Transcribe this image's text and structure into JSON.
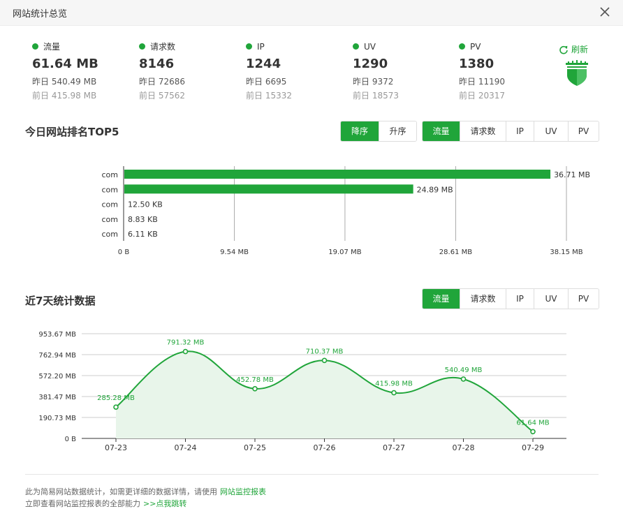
{
  "window": {
    "title": "网站统计总览"
  },
  "stats": [
    {
      "label": "流量",
      "value": "61.64 MB",
      "yesterday": "昨日 540.49 MB",
      "before": "前日 415.98 MB"
    },
    {
      "label": "请求数",
      "value": "8146",
      "yesterday": "昨日 72686",
      "before": "前日 57562"
    },
    {
      "label": "IP",
      "value": "1244",
      "yesterday": "昨日 6695",
      "before": "前日 15332"
    },
    {
      "label": "UV",
      "value": "1290",
      "yesterday": "昨日 9372",
      "before": "前日 18573"
    },
    {
      "label": "PV",
      "value": "1380",
      "yesterday": "昨日 11190",
      "before": "前日 20317"
    }
  ],
  "refresh_label": "刷新",
  "top5": {
    "title": "今日网站排名TOP5",
    "sort_buttons": [
      "降序",
      "升序"
    ],
    "sort_active": 0,
    "metric_buttons": [
      "流量",
      "请求数",
      "IP",
      "UV",
      "PV"
    ],
    "metric_active": 0
  },
  "week": {
    "title": "近7天统计数据",
    "metric_buttons": [
      "流量",
      "请求数",
      "IP",
      "UV",
      "PV"
    ],
    "metric_active": 0
  },
  "chart_data": [
    {
      "type": "bar",
      "orientation": "horizontal",
      "categories": [
        "com",
        "com",
        "com",
        "com",
        "com"
      ],
      "values": [
        36.71,
        24.89,
        0.0122,
        0.0086,
        0.006
      ],
      "value_labels": [
        "36.71 MB",
        "24.89 MB",
        "12.50 KB",
        "8.83 KB",
        "6.11 KB"
      ],
      "unit": "MB",
      "xlim": [
        0,
        38.15
      ],
      "x_ticks": [
        0,
        9.54,
        19.07,
        28.61,
        38.15
      ],
      "x_tick_labels": [
        "0 B",
        "9.54 MB",
        "19.07 MB",
        "28.61 MB",
        "38.15 MB"
      ],
      "grid": true,
      "color": "#20a53a"
    },
    {
      "type": "area",
      "x": [
        "07-23",
        "07-24",
        "07-25",
        "07-26",
        "07-27",
        "07-28",
        "07-29"
      ],
      "values": [
        285.28,
        791.32,
        452.78,
        710.37,
        415.98,
        540.49,
        61.64
      ],
      "value_labels": [
        "285.28 MB",
        "791.32 MB",
        "452.78 MB",
        "710.37 MB",
        "415.98 MB",
        "540.49 MB",
        "61.64 MB"
      ],
      "unit": "MB",
      "ylim": [
        0,
        953.67
      ],
      "y_ticks": [
        0,
        190.73,
        381.47,
        572.2,
        762.94,
        953.67
      ],
      "y_tick_labels": [
        "0 B",
        "190.73 MB",
        "381.47 MB",
        "572.20 MB",
        "762.94 MB",
        "953.67 MB"
      ],
      "grid": true,
      "smooth": true,
      "color": "#20a53a"
    }
  ],
  "footer": {
    "line1": "此为简易网站数据统计，如需更详细的数据详情，请使用",
    "link1": "网站监控报表",
    "line2": "立即查看网站监控报表的全部能力",
    "link2": ">>点我跳转"
  },
  "colors": {
    "accent": "#20a53a",
    "area_fill": "#e8f5ea",
    "grid": "#cccccc"
  }
}
